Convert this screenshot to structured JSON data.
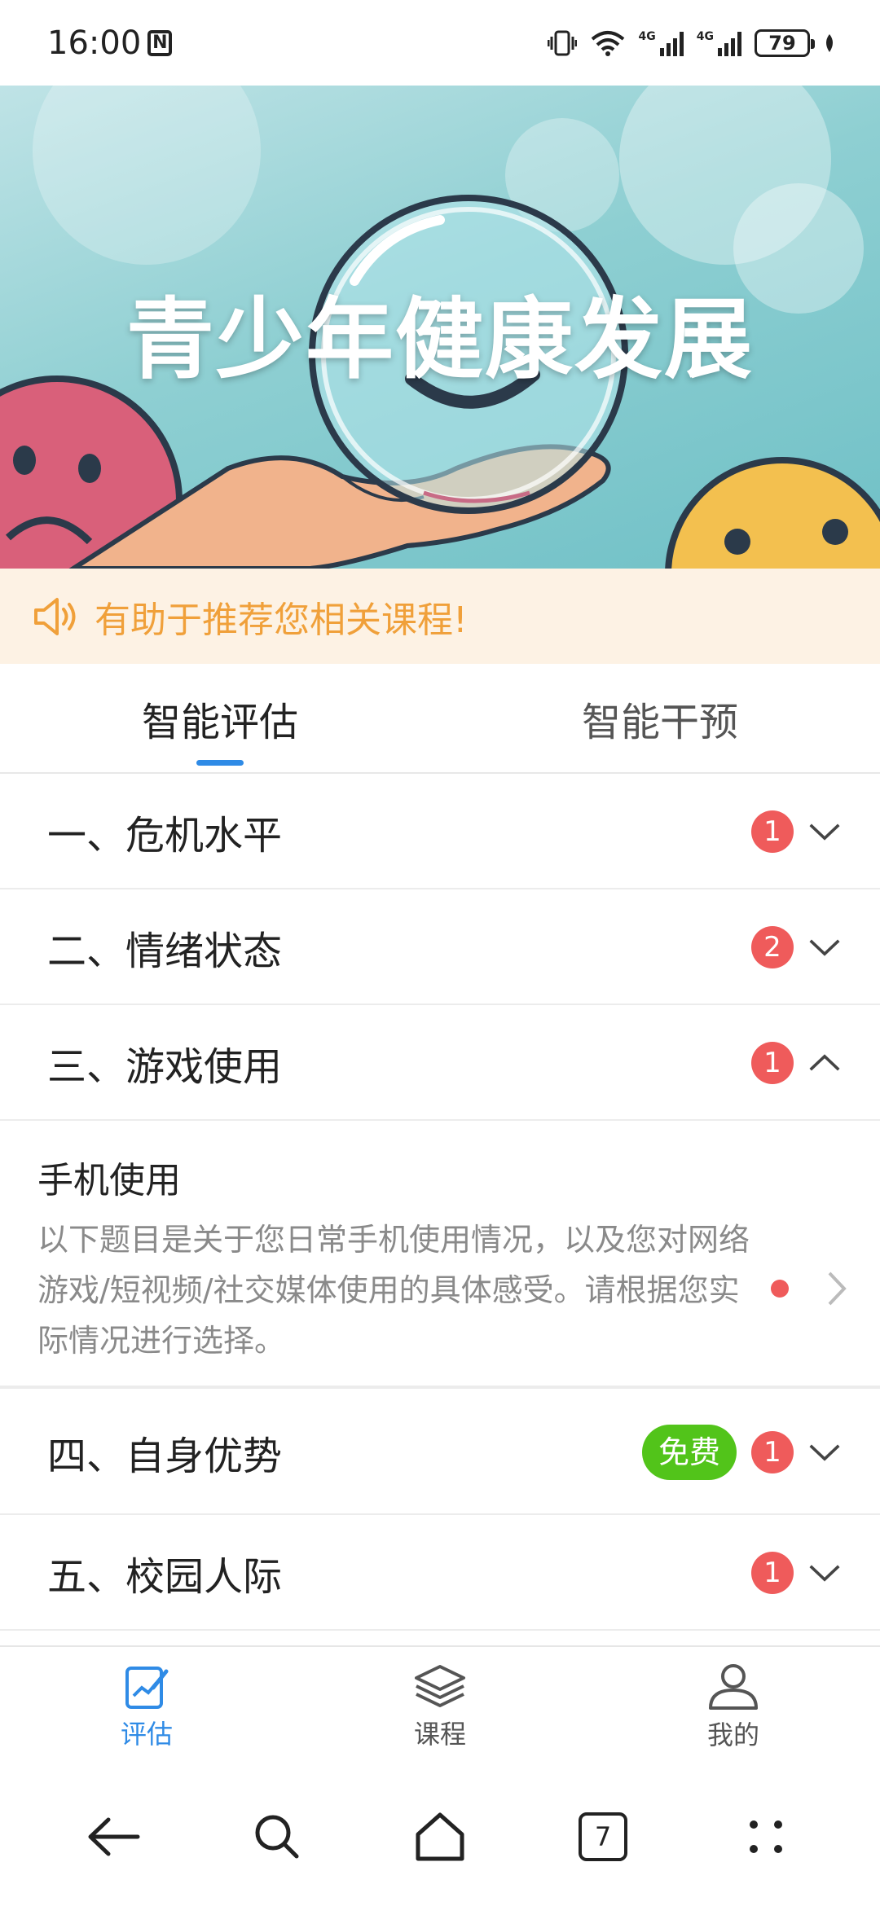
{
  "status_bar": {
    "time": "16:00",
    "battery": "79",
    "network_1": "4G",
    "network_2": "4G"
  },
  "banner": {
    "title": "青少年健康发展"
  },
  "notice": {
    "text": "有助于推荐您相关课程!"
  },
  "tabs": [
    {
      "label": "智能评估",
      "active": true
    },
    {
      "label": "智能干预",
      "active": false
    }
  ],
  "sections": [
    {
      "title": "一、危机水平",
      "badge": "1",
      "expanded": false
    },
    {
      "title": "二、情绪状态",
      "badge": "2",
      "expanded": false
    },
    {
      "title": "三、游戏使用",
      "badge": "1",
      "expanded": true
    },
    {
      "title": "四、自身优势",
      "badge": "1",
      "tag": "免费",
      "expanded": false
    },
    {
      "title": "五、校园人际",
      "badge": "1",
      "expanded": false
    }
  ],
  "sub_item": {
    "title": "手机使用",
    "description": "以下题目是关于您日常手机使用情况，以及您对网络游戏/短视频/社交媒体使用的具体感受。请根据您实际情况进行选择。"
  },
  "bottom_nav": [
    {
      "label": "评估",
      "icon": "edit-chart-icon",
      "active": true
    },
    {
      "label": "课程",
      "icon": "layers-icon",
      "active": false
    },
    {
      "label": "我的",
      "icon": "user-icon",
      "active": false
    }
  ],
  "system_nav": {
    "tab_count": "7"
  },
  "colors": {
    "accent": "#2f8be6",
    "badge": "#ef5b5b",
    "free": "#52c41a",
    "notice_text": "#f0a03a",
    "notice_bg": "#fdf2e4"
  }
}
